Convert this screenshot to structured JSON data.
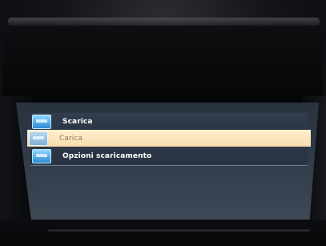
{
  "menu": {
    "items": [
      {
        "label": "Scarica",
        "icon": "download-icon",
        "selected": false
      },
      {
        "label": "Carica",
        "icon": "upload-icon",
        "selected": true
      },
      {
        "label": "Opzioni scaricamento",
        "icon": "settings-icon",
        "selected": false
      }
    ]
  },
  "colors": {
    "screen_bg": "#2f3947",
    "highlight": "#f7dcae",
    "highlight_text": "#8a7a55",
    "text": "#ffffff",
    "icon": "#2c8bd6"
  }
}
